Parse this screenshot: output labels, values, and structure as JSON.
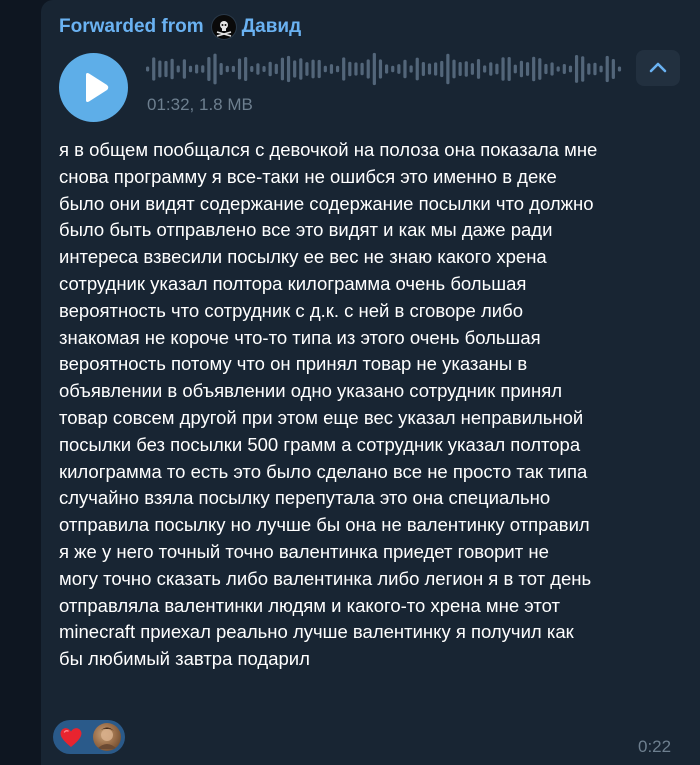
{
  "forward": {
    "prefix": "Forwarded from",
    "sender_name": "Давид"
  },
  "voice_message": {
    "duration": "01:32",
    "size": "1.8 MB",
    "meta": "01:32, 1.8 MB"
  },
  "message": {
    "lines": [
      "я в общем пообщался с девочкой на полоза она показала мне",
      "снова программу я все-таки не ошибся это именно в деке",
      "было они видят содержание содержание посылки что должно",
      "было быть отправлено все это видят и как мы даже ради",
      "интереса взвесили посылку ее вес не знаю какого хрена",
      "сотрудник указал полтора килограмма очень большая",
      "вероятность что сотрудник с д.к. с ней в сговоре либо",
      "знакомая не короче что-то типа из этого очень большая",
      "вероятность потому что он принял товар не указаны в",
      "объявлении в объявлении одно указано сотрудник принял",
      "товар совсем другой при этом еще вес указал неправильной",
      "посылки без посылки 500 грамм а сотрудник указал полтора",
      "килограмма то есть это было сделано все не просто так типа",
      "случайно взяла посылку перепутала это она специально",
      "отправила посылку но лучше бы она не валентинку отправил",
      "я же у него точный точно валентинка приедет говорит не",
      "могу точно сказать либо валентинка либо легион я в тот день",
      "отправляла валентинки людям и какого-то хрена мне этот",
      "minecraft приехал реально лучше валентинку я получил как",
      "бы любимый завтра подарил"
    ],
    "time": "0:22"
  },
  "reactions": [
    {
      "icon": "heart-icon"
    }
  ],
  "colors": {
    "background": "#0e1621",
    "bubble": "#182533",
    "accent": "#6ab2f2",
    "play_button": "#5eaee8",
    "meta_text": "#6d7f8f"
  }
}
